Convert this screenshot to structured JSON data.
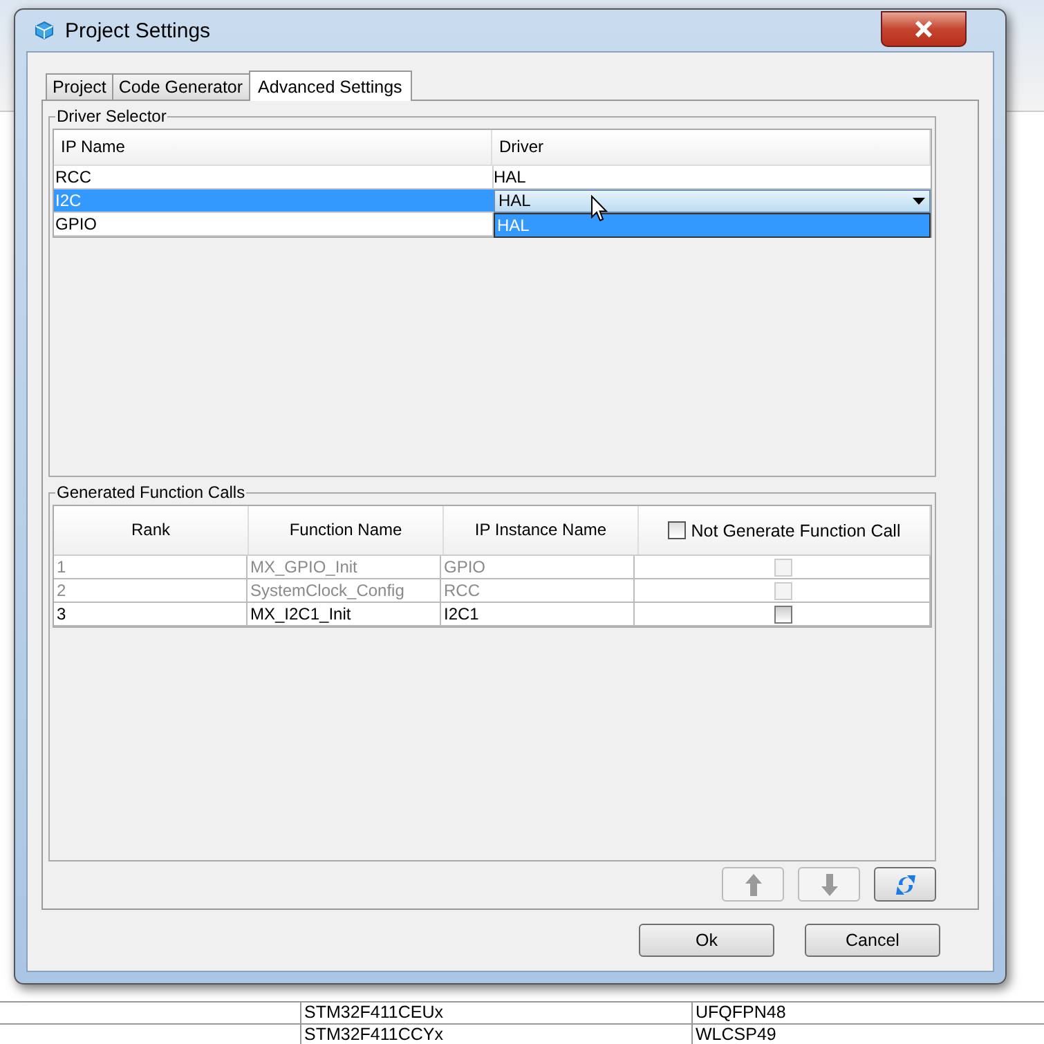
{
  "window": {
    "title": "Project Settings"
  },
  "tabs": [
    {
      "label": "Project",
      "selected": false
    },
    {
      "label": "Code Generator",
      "selected": false
    },
    {
      "label": "Advanced Settings",
      "selected": true
    }
  ],
  "driver_selector": {
    "title": "Driver Selector",
    "columns": [
      "IP Name",
      "Driver"
    ],
    "rows": [
      {
        "ip_name": "RCC",
        "driver": "HAL",
        "selected": false
      },
      {
        "ip_name": "I2C",
        "driver": "HAL",
        "selected": true
      },
      {
        "ip_name": "GPIO",
        "driver": "",
        "selected": false
      }
    ],
    "dropdown_options": [
      {
        "label": "HAL",
        "selected": true
      }
    ]
  },
  "function_calls": {
    "title": "Generated Function Calls",
    "columns": [
      "Rank",
      "Function Name",
      "IP Instance Name"
    ],
    "header_checkbox": {
      "label": "Not Generate Function Call",
      "checked": false
    },
    "rows": [
      {
        "rank": "1",
        "function_name": "MX_GPIO_Init",
        "ip_instance": "GPIO",
        "disabled": true,
        "checked": false
      },
      {
        "rank": "2",
        "function_name": "SystemClock_Config",
        "ip_instance": "RCC",
        "disabled": true,
        "checked": false
      },
      {
        "rank": "3",
        "function_name": "MX_I2C1_Init",
        "ip_instance": "I2C1",
        "disabled": false,
        "checked": false
      }
    ]
  },
  "order_buttons": [
    {
      "kind": "up",
      "disabled": true
    },
    {
      "kind": "down",
      "disabled": true
    },
    {
      "kind": "refresh",
      "disabled": false
    }
  ],
  "buttons": [
    "Ok",
    "Cancel"
  ],
  "background_table": {
    "rows": [
      [
        "STM32F411CEUx",
        "UFQFPN48"
      ],
      [
        "STM32F411CCYx",
        "WLCSP49"
      ]
    ]
  }
}
